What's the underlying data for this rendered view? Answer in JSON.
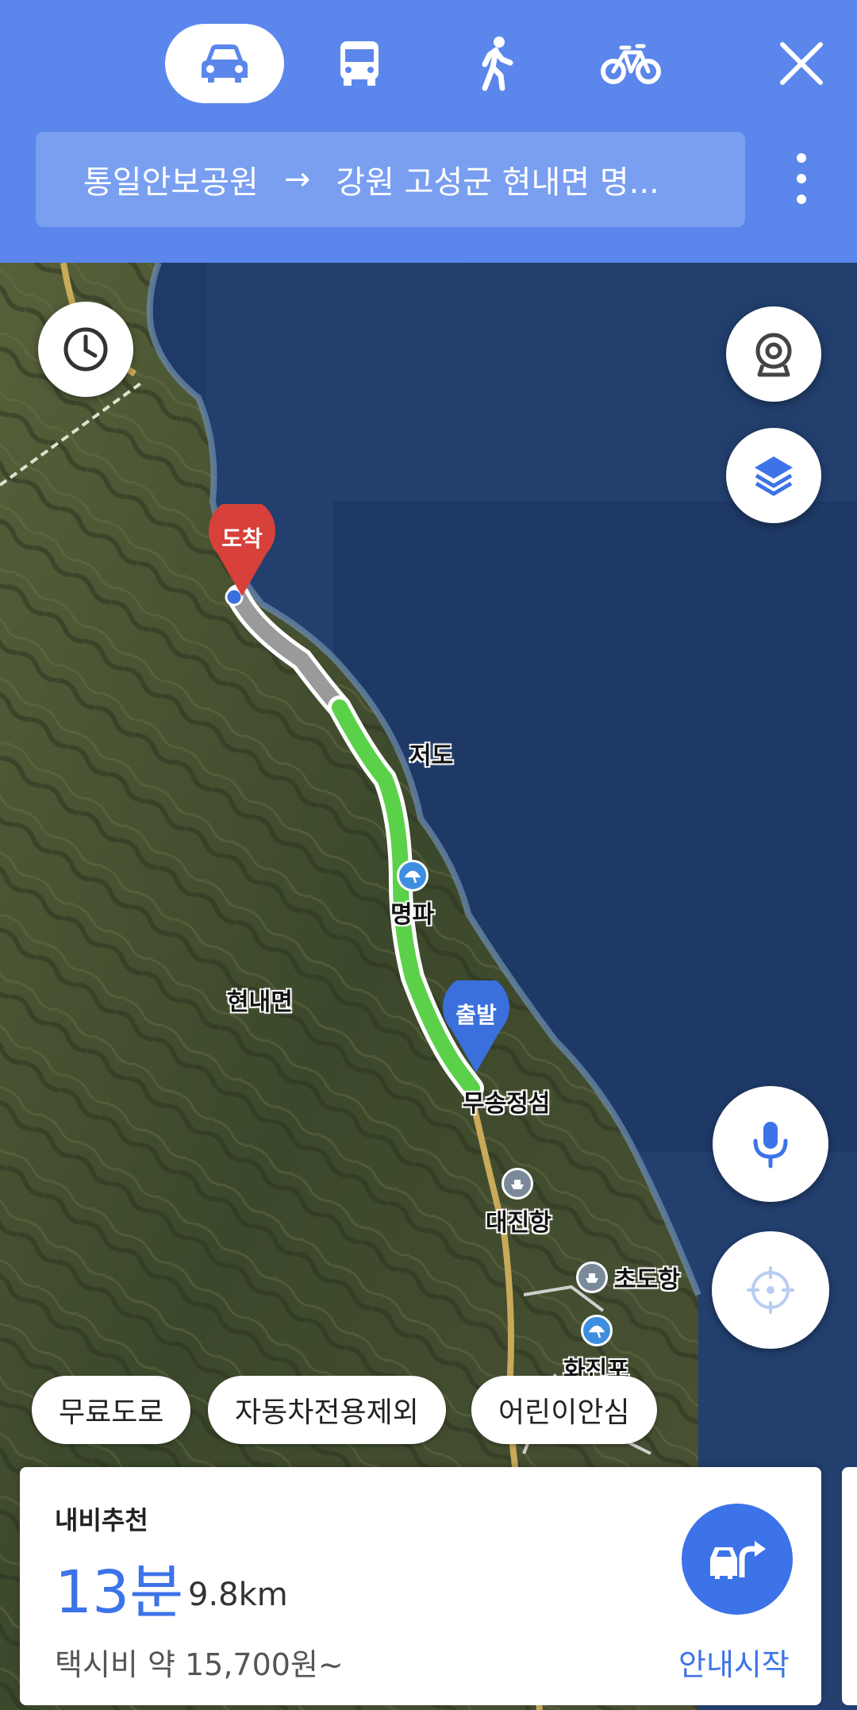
{
  "header": {
    "modes": [
      {
        "name": "car-icon",
        "label": "자동차",
        "active": true
      },
      {
        "name": "bus-icon",
        "label": "대중교통",
        "active": false
      },
      {
        "name": "walk-icon",
        "label": "도보",
        "active": false
      },
      {
        "name": "bicycle-icon",
        "label": "자전거",
        "active": false
      }
    ],
    "origin": "통일안보공원",
    "arrow": "→",
    "destination": "강원 고성군 현내면 명..."
  },
  "map": {
    "labels": {
      "jeodo": "저도",
      "myeongpa": "명파",
      "hyeonnaemyeon": "현내면",
      "musongjeongseom": "무송정섬",
      "daejinhang": "대진항",
      "chodohang": "초도항",
      "hwajinpo": "화진포"
    },
    "pins": {
      "arrival": "도착",
      "departure": "출발"
    },
    "colors": {
      "route_green": "#5bd14a",
      "route_gray": "#9a9a9a",
      "arrival_pin": "#d8403a",
      "departure_pin": "#3a6fdc",
      "sea": "#1f3a66",
      "land": "#3e4a2c"
    }
  },
  "chips": [
    "무료도로",
    "자동차전용제외",
    "어린이안심"
  ],
  "card": {
    "label": "내비추천",
    "time": "13분",
    "distance": "9.8km",
    "fare": "택시비 약 15,700원~",
    "start_label": "안내시작"
  }
}
